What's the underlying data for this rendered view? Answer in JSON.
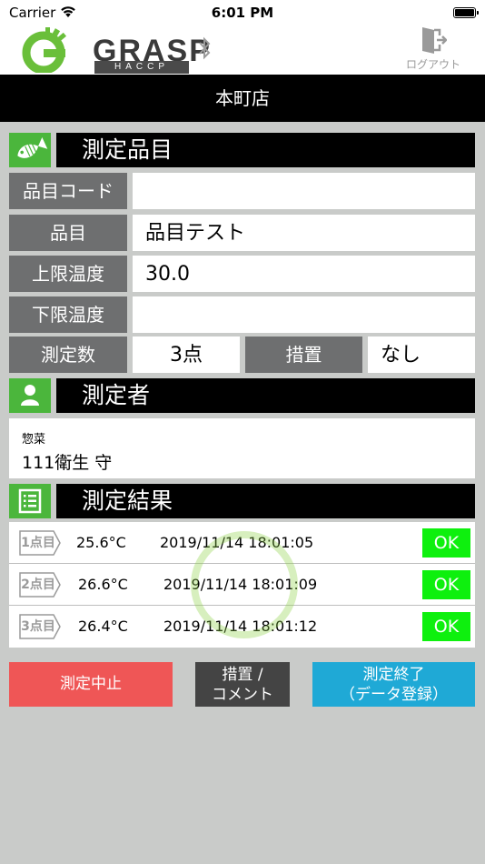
{
  "status_bar": {
    "carrier": "Carrier",
    "time": "6:01 PM"
  },
  "header": {
    "logo_text": "GRASP",
    "logo_sub": "HACCP",
    "logout_label": "ログアウト"
  },
  "store": {
    "name": "本町店"
  },
  "item_section": {
    "title": "測定品目",
    "item_code_label": "品目コード",
    "item_code_value": "",
    "item_label": "品目",
    "item_value": "品目テスト",
    "upper_temp_label": "上限温度",
    "upper_temp_value": "30.0",
    "lower_temp_label": "下限温度",
    "lower_temp_value": "",
    "count_label": "測定数",
    "count_value": "3点",
    "action_label": "措置",
    "action_value": "なし"
  },
  "measurer_section": {
    "title": "測定者",
    "department": "惣菜",
    "name": "111衛生 守"
  },
  "results_section": {
    "title": "測定結果",
    "rows": [
      {
        "point": "1点目",
        "temp": "25.6°C",
        "timestamp": "2019/11/14 18:01:05",
        "status": "OK"
      },
      {
        "point": "2点目",
        "temp": "26.6°C",
        "timestamp": "2019/11/14 18:01:09",
        "status": "OK"
      },
      {
        "point": "3点目",
        "temp": "26.4°C",
        "timestamp": "2019/11/14 18:01:12",
        "status": "OK"
      }
    ]
  },
  "buttons": {
    "stop": "測定中止",
    "action_line1": "措置 /",
    "action_line2": "コメント",
    "finish_line1": "測定終了",
    "finish_line2": "（データ登録）"
  },
  "colors": {
    "accent_green": "#4bb63c",
    "ok_green": "#0ef00e",
    "stop_red": "#ef5656",
    "finish_blue": "#1fa9d6",
    "label_gray": "#6e6f70",
    "background_gray": "#c9cbc9"
  },
  "icons": {
    "item_section": "fish-icon",
    "measurer_section": "person-icon",
    "results_section": "list-icon",
    "logout": "door-exit-icon",
    "status": [
      "wifi-icon",
      "battery-icon"
    ],
    "bluetooth": "bluetooth-icon"
  }
}
